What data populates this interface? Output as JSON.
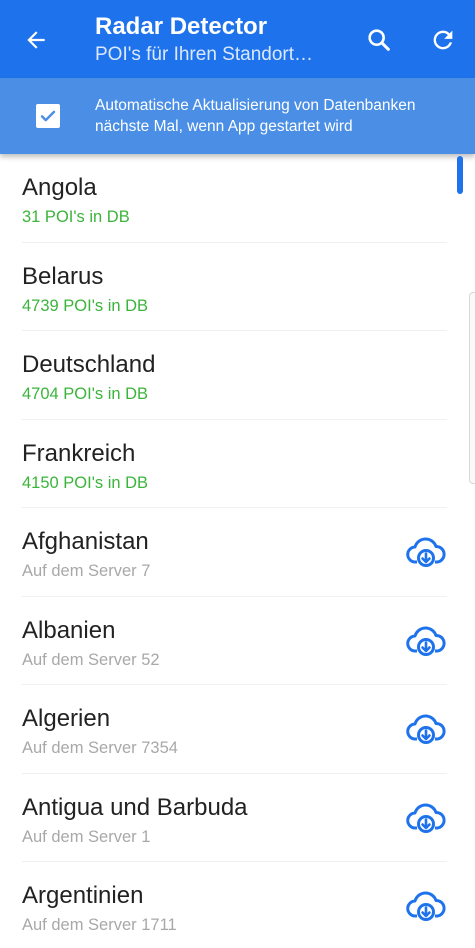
{
  "appbar": {
    "title": "Radar Detector",
    "subtitle": "POI's für Ihren Standort…",
    "icons": {
      "back": "back-arrow-icon",
      "search": "search-icon",
      "refresh": "refresh-icon"
    },
    "color": "#1e73ec"
  },
  "banner": {
    "checked": true,
    "line1": "Automatische Aktualisierung von Datenbanken",
    "line2": "nächste Mal, wenn App gestartet wird",
    "color": "#4a8fe5"
  },
  "countries": [
    {
      "name": "Angola",
      "status": "31 POI's in DB"
    },
    {
      "name": "Belarus",
      "status": "4739 POI's in DB"
    },
    {
      "name": "Deutschland",
      "status": "4704 POI's in DB"
    },
    {
      "name": "Frankreich",
      "status": "4150 POI's in DB"
    },
    {
      "name": "Afghanistan",
      "status": "Auf dem Server 7"
    },
    {
      "name": "Albanien",
      "status": "Auf dem Server 52"
    },
    {
      "name": "Algerien",
      "status": "Auf dem Server 7354"
    },
    {
      "name": "Antigua und Barbuda",
      "status": "Auf dem Server 1"
    },
    {
      "name": "Argentinien",
      "status": "Auf dem Server 1711"
    }
  ],
  "colors": {
    "in_db": "#3bb43b",
    "on_server": "#a8a8a8",
    "download_icon": "#1e73ec"
  },
  "download_icon": "cloud-download-icon"
}
